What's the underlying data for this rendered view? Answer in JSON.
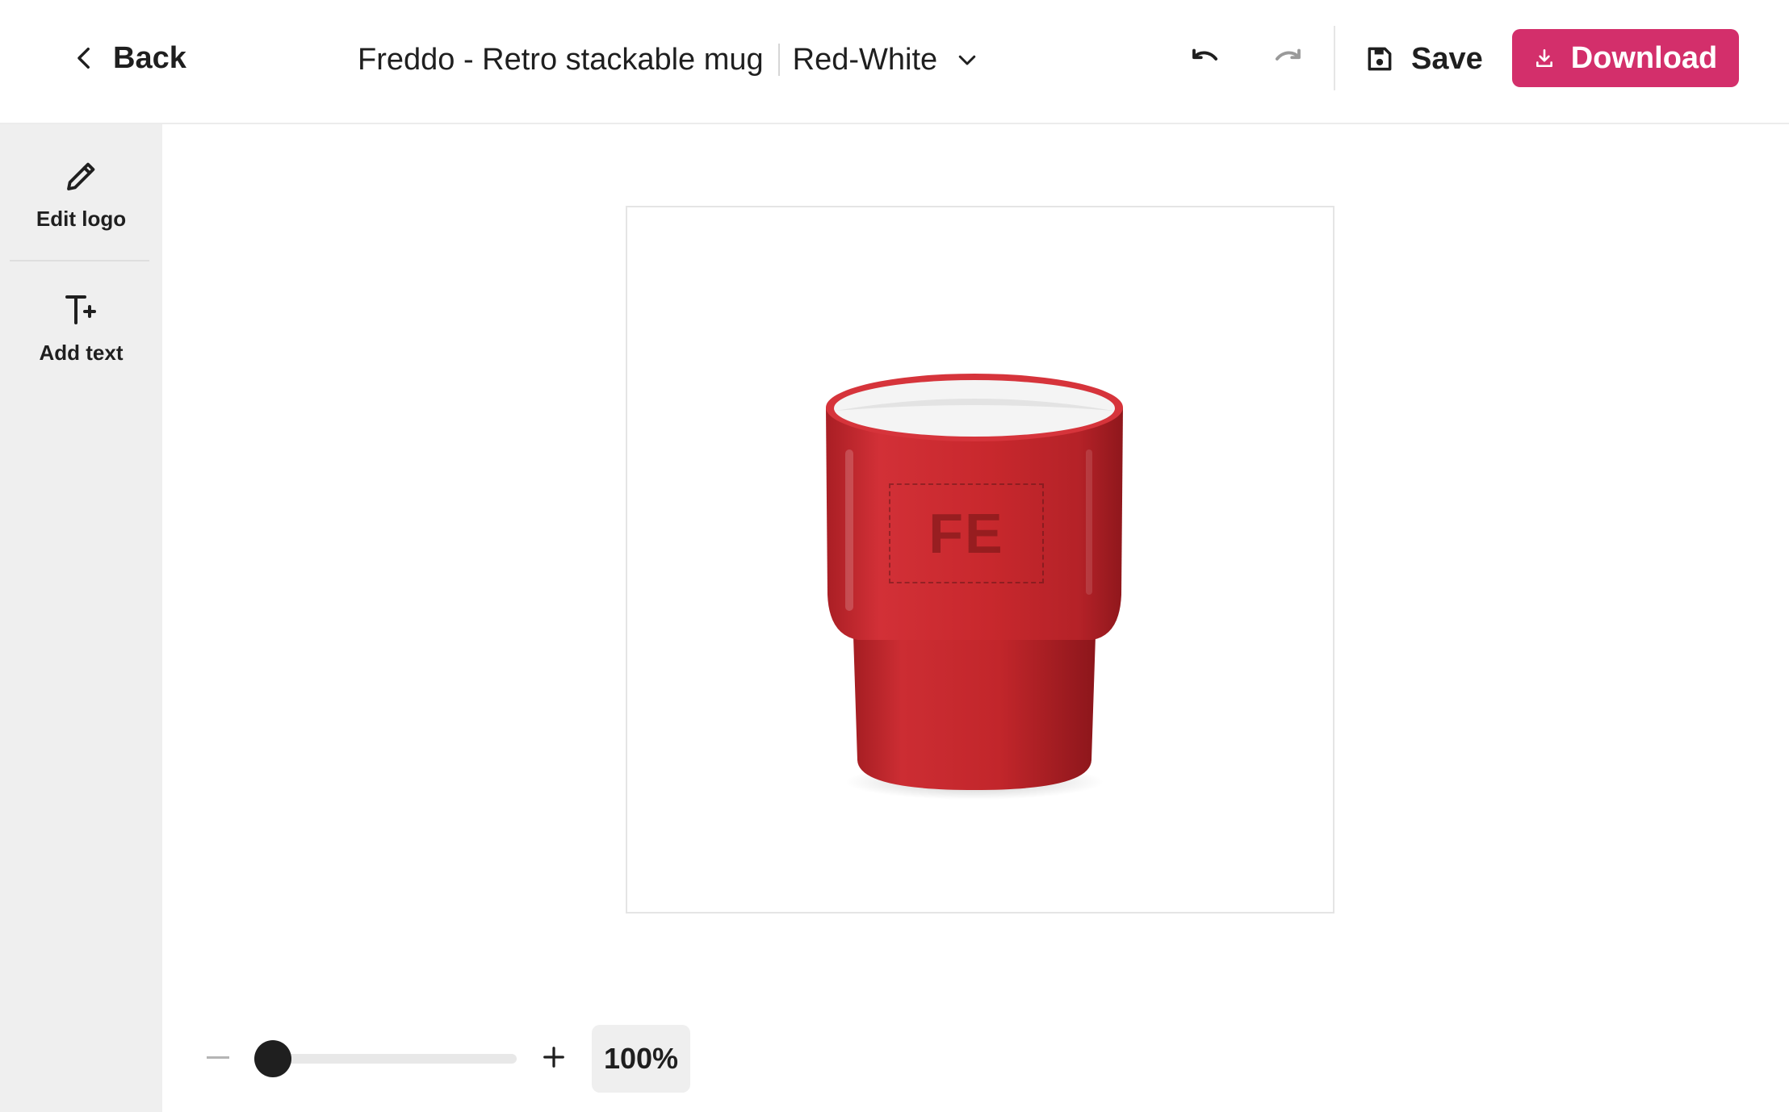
{
  "header": {
    "back_label": "Back",
    "product_name": "Freddo - Retro stackable mug",
    "variant": "Red-White",
    "save_label": "Save",
    "download_label": "Download"
  },
  "sidebar": {
    "tools": [
      {
        "label": "Edit logo",
        "icon": "pencil-icon"
      },
      {
        "label": "Add text",
        "icon": "add-text-icon"
      }
    ]
  },
  "canvas": {
    "logo_placeholder": "FE",
    "mug_color": "#c8282d",
    "mug_interior_color": "#f4f4f4"
  },
  "zoom": {
    "value_label": "100%",
    "level": 0
  },
  "colors": {
    "accent": "#d32f6b",
    "sidebar_bg": "#efefef",
    "text": "#1f1f1f"
  }
}
